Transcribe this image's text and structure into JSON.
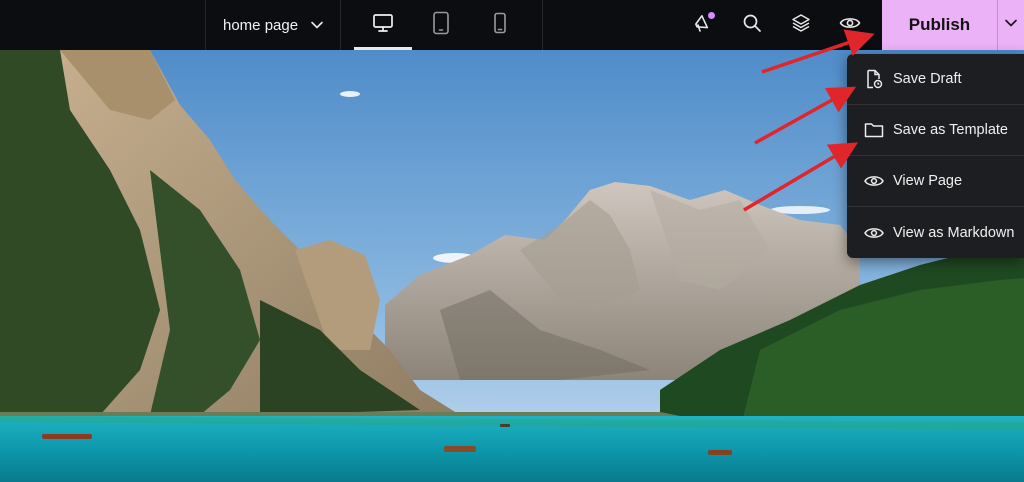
{
  "topbar": {
    "page_selector": {
      "label": "home page",
      "icon": "chevron-down-icon"
    },
    "devices": [
      {
        "name": "desktop",
        "icon": "monitor-icon",
        "active": true
      },
      {
        "name": "tablet",
        "icon": "tablet-icon",
        "active": false
      },
      {
        "name": "mobile",
        "icon": "phone-icon",
        "active": false
      }
    ],
    "tools": [
      {
        "icon": "megaphone-icon",
        "has_notification": true
      },
      {
        "icon": "search-icon"
      },
      {
        "icon": "layers-icon"
      },
      {
        "icon": "eye-icon"
      }
    ],
    "publish_label": "Publish",
    "publish_more_icon": "chevron-down-icon"
  },
  "publish_menu": {
    "items": [
      {
        "label": "Save Draft",
        "icon": "file-clock-icon"
      },
      {
        "label": "Save as Template",
        "icon": "folder-icon"
      },
      {
        "label": "View Page",
        "icon": "eye-icon"
      },
      {
        "label": "View as Markdown",
        "icon": "eye-icon"
      }
    ]
  },
  "colors": {
    "topbar_bg": "#0c0d10",
    "publish_bg": "#ebb2f7",
    "menu_bg": "#1d1e21",
    "annotation_arrow": "#e0262b",
    "notification_dot": "#d58cff"
  }
}
